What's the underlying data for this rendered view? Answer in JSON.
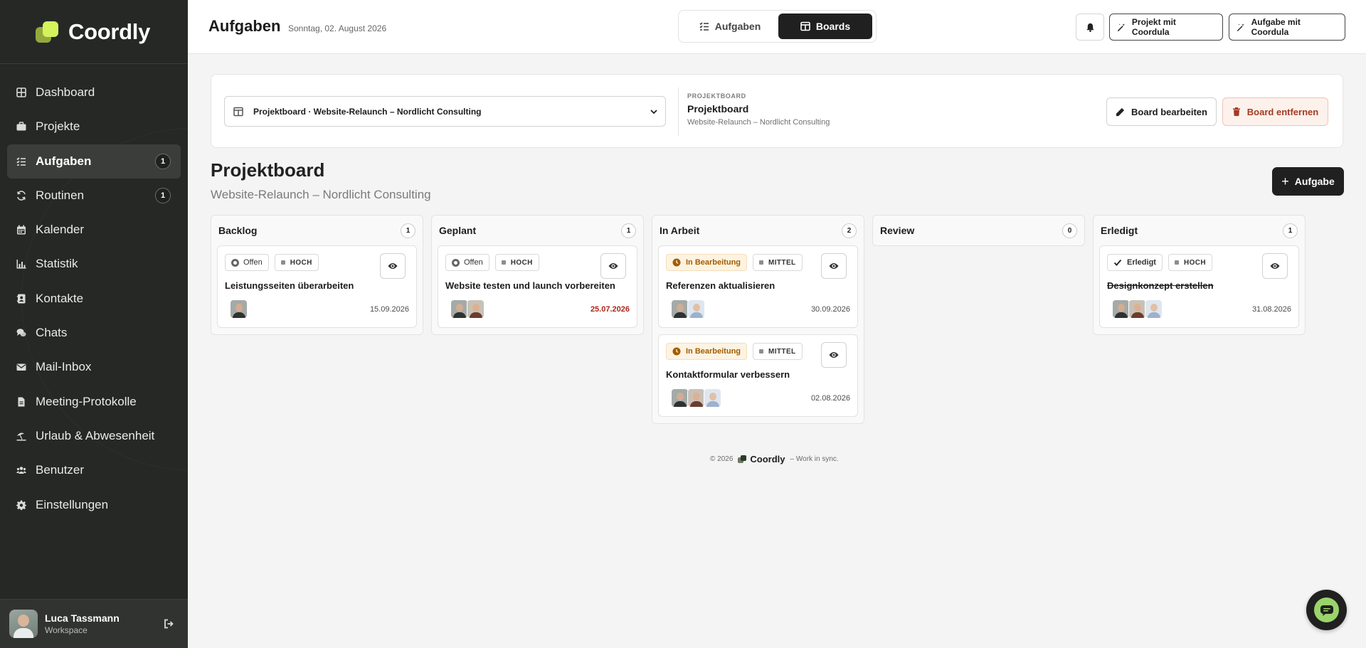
{
  "brand": {
    "name": "Coordly"
  },
  "sidebar": {
    "items": [
      {
        "label": "Dashboard",
        "icon": "dashboard-icon"
      },
      {
        "label": "Projekte",
        "icon": "briefcase-icon"
      },
      {
        "label": "Aufgaben",
        "icon": "tasks-icon",
        "badge": "1",
        "active": true
      },
      {
        "label": "Routinen",
        "icon": "refresh-icon",
        "badge": "1"
      },
      {
        "label": "Kalender",
        "icon": "calendar-icon"
      },
      {
        "label": "Statistik",
        "icon": "chart-icon"
      },
      {
        "label": "Kontakte",
        "icon": "contact-book-icon"
      },
      {
        "label": "Chats",
        "icon": "chat-icon"
      },
      {
        "label": "Mail-Inbox",
        "icon": "mail-icon"
      },
      {
        "label": "Meeting-Protokolle",
        "icon": "document-icon"
      },
      {
        "label": "Urlaub & Abwesenheit",
        "icon": "umbrella-beach-icon"
      },
      {
        "label": "Benutzer",
        "icon": "users-icon"
      },
      {
        "label": "Einstellungen",
        "icon": "gear-icon"
      }
    ],
    "profile": {
      "name": "Luca Tassmann",
      "workspace": "Workspace"
    }
  },
  "header": {
    "title": "Aufgaben",
    "date": "Sonntag, 02. August 2026",
    "views": [
      {
        "label": "Aufgaben",
        "active": false
      },
      {
        "label": "Boards",
        "active": true
      }
    ],
    "buttons": {
      "project_ai": "Projekt mit Coordula",
      "task_ai": "Aufgabe mit Coordula"
    }
  },
  "board_selector": {
    "selected": "Projektboard · Website-Relaunch – Nordlicht Consulting",
    "eyebrow": "PROJEKTBOARD",
    "title": "Projektboard",
    "subtitle": "Website-Relaunch – Nordlicht Consulting",
    "edit_label": "Board bearbeiten",
    "remove_label": "Board entfernen"
  },
  "board": {
    "title": "Projektboard",
    "subtitle": "Website-Relaunch – Nordlicht Consulting",
    "add_label": "Aufgabe",
    "columns": [
      {
        "name": "Backlog",
        "count": "1",
        "cards": [
          {
            "status": "Offen",
            "priority": "HOCH",
            "title": "Leistungsseiten überarbeiten",
            "date": "15.09.2026"
          }
        ]
      },
      {
        "name": "Geplant",
        "count": "1",
        "cards": [
          {
            "status": "Offen",
            "priority": "HOCH",
            "title": "Website testen und launch vorbereiten",
            "date": "25.07.2026",
            "overdue": true
          }
        ]
      },
      {
        "name": "In Arbeit",
        "count": "2",
        "cards": [
          {
            "status": "In Bearbeitung",
            "priority": "MITTEL",
            "title": "Referenzen aktualisieren",
            "date": "30.09.2026"
          },
          {
            "status": "In Bearbeitung",
            "priority": "MITTEL",
            "title": "Kontaktformular verbessern",
            "date": "02.08.2026"
          }
        ]
      },
      {
        "name": "Review",
        "count": "0",
        "cards": []
      },
      {
        "name": "Erledigt",
        "count": "1",
        "cards": [
          {
            "status": "Erledigt",
            "priority": "HOCH",
            "title": "Designkonzept erstellen",
            "date": "31.08.2026",
            "done": true
          }
        ]
      }
    ]
  },
  "footer": {
    "copyright": "© 2026",
    "brand": "Coordly",
    "tagline": "– Work in sync."
  },
  "colors": {
    "sidebar": "#262826",
    "accent": "#d4f25c",
    "primary_button": "#1f201f",
    "danger": "#a43a22",
    "in_progress": "#a25d00"
  }
}
